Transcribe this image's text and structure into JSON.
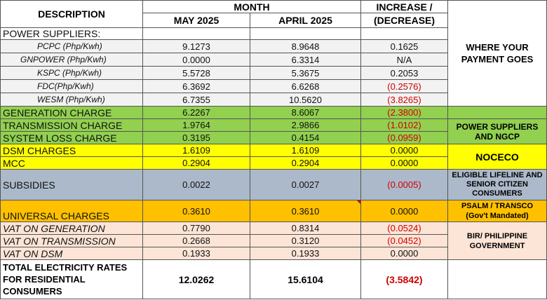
{
  "header": {
    "description": "DESCRIPTION",
    "month": "MONTH",
    "may": "MAY 2025",
    "april": "APRIL 2025",
    "increase": "INCREASE /",
    "decrease": "(DECREASE)"
  },
  "power_suppliers_label": "POWER SUPPLIERS:",
  "suppliers": [
    {
      "name": "PCPC (Php/Kwh)",
      "may": "9.1273",
      "april": "8.9648",
      "change": "0.1625",
      "negative": false
    },
    {
      "name": "GNPOWER (Php/Kwh)",
      "may": "0.0000",
      "april": "6.3314",
      "change": "N/A",
      "negative": false
    },
    {
      "name": "KSPC (Php/Kwh)",
      "may": "5.5728",
      "april": "5.3675",
      "change": "0.2053",
      "negative": false
    },
    {
      "name": "FDC(Php/Kwh)",
      "may": "6.3692",
      "april": "6.6268",
      "change": "(0.2576)",
      "negative": true
    },
    {
      "name": "WESM (Php/Kwh)",
      "may": "6.7355",
      "april": "10.5620",
      "change": "(3.8265)",
      "negative": true
    }
  ],
  "charges": {
    "generation": {
      "name": "GENERATION CHARGE",
      "may": "6.2267",
      "april": "8.6067",
      "change": "(2.3800)"
    },
    "transmission": {
      "name": "TRANSMISSION CHARGE",
      "may": "1.9764",
      "april": "2.9866",
      "change": "(1.0102)"
    },
    "system_loss": {
      "name": "SYSTEM LOSS CHARGE",
      "may": "0.3195",
      "april": "0.4154",
      "change": "(0.0959)"
    },
    "dsm": {
      "name": "DSM CHARGES",
      "may": "1.6109",
      "april": "1.6109",
      "change": "0.0000"
    },
    "mcc": {
      "name": "MCC",
      "may": "0.2904",
      "april": "0.2904",
      "change": "0.0000"
    },
    "subsidies": {
      "name": "SUBSIDIES",
      "may": "0.0022",
      "april": "0.0027",
      "change": "(0.0005)"
    },
    "universal": {
      "name": "UNIVERSAL CHARGES",
      "may": "0.3610",
      "april": "0.3610",
      "change": "0.0000"
    },
    "vat_generation": {
      "name": "VAT ON GENERATION",
      "may": "0.7790",
      "april": "0.8314",
      "change": "(0.0524)"
    },
    "vat_transmission": {
      "name": "VAT ON TRANSMISSION",
      "may": "0.2668",
      "april": "0.3120",
      "change": "(0.0452)"
    },
    "vat_dsm": {
      "name": "VAT ON DSM",
      "may": "0.1933",
      "april": "0.1933",
      "change": "0.0000"
    }
  },
  "total": {
    "line1": "TOTAL ELECTRICITY RATES",
    "line2": "FOR RESIDENTIAL",
    "line3": "CONSUMERS",
    "may": "12.0262",
    "april": "15.6104",
    "change": "(3.5842)"
  },
  "side": {
    "where_title": "WHERE YOUR PAYMENT GOES",
    "power_ngcp": "POWER SUPPLIERS AND NGCP",
    "noceco": "NOCECO",
    "eligible": "ELIGIBLE LIFELINE AND SENIOR CITIZEN CONSUMERS",
    "psalm_line1": "PSALM / TRANSCO",
    "psalm_line2": "(Gov't Mandated)",
    "bir": "BIR/ PHILIPPINE GOVERNMENT"
  },
  "colors": {
    "green": "#92d050",
    "yellow": "#ffff00",
    "gray": "#acb9ca",
    "orange": "#ffc000",
    "pink": "#fce4d6",
    "negative": "#d00000"
  }
}
